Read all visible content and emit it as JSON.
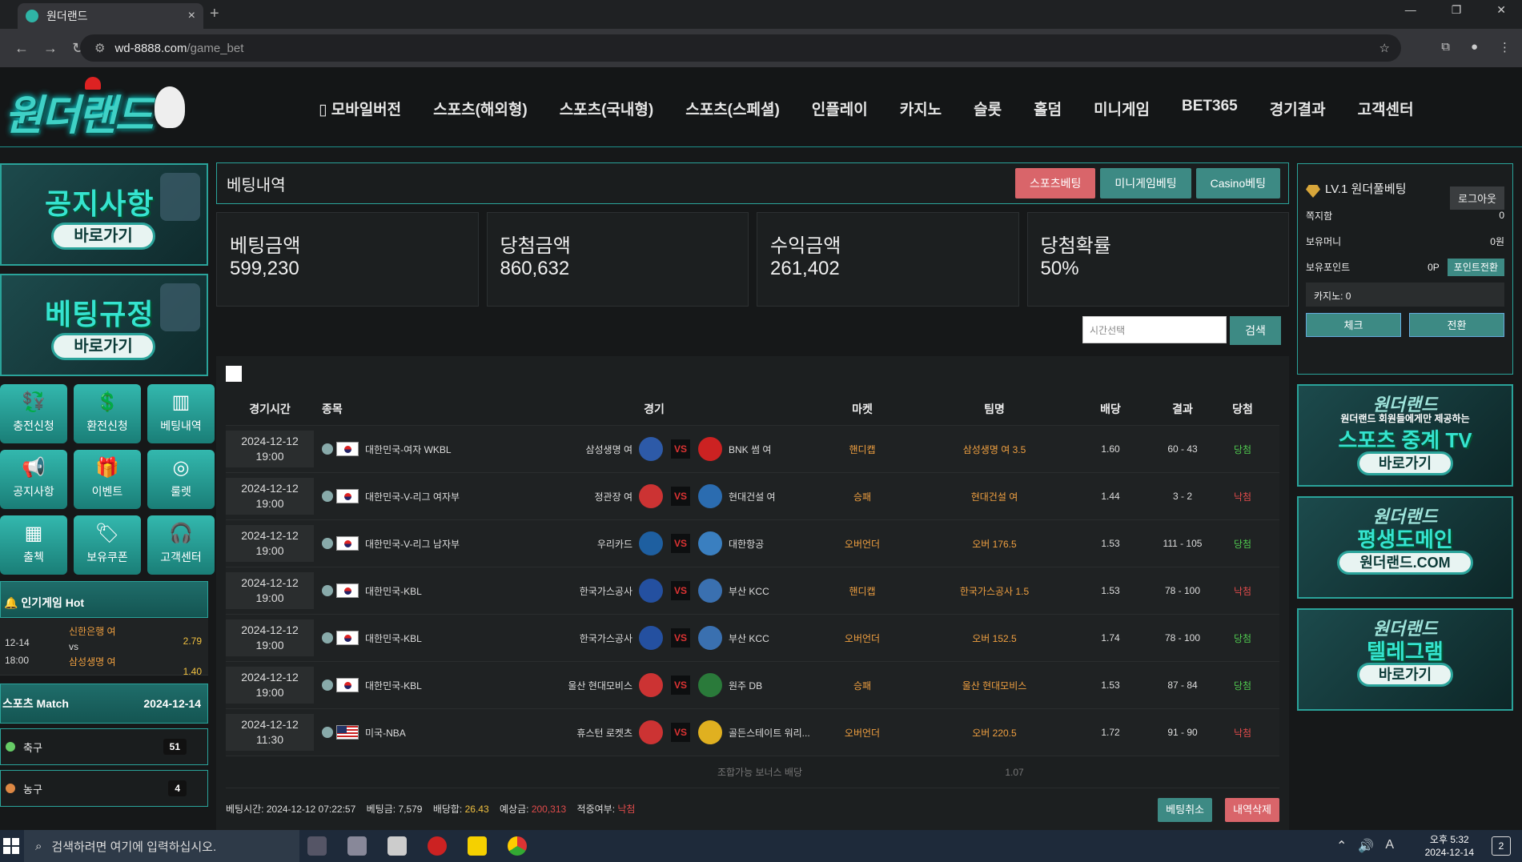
{
  "browser": {
    "tab_title": "원더랜드",
    "url_host": "wd-8888.com",
    "url_path": "/game_bet"
  },
  "header": {
    "logo_text": "원더랜드",
    "menu": [
      "▯ 모바일버전",
      "스포츠(해외형)",
      "스포츠(국내형)",
      "스포츠(스페셜)",
      "인플레이",
      "카지노",
      "슬롯",
      "홀덤",
      "미니게임",
      "BET365",
      "경기결과",
      "고객센터"
    ]
  },
  "left": {
    "banners": [
      {
        "title": "공지사항",
        "button": "바로가기"
      },
      {
        "title": "베팅규정",
        "button": "바로가기"
      }
    ],
    "quick": [
      {
        "icon": "money-icon",
        "glyph": "💱",
        "label": "충전신청"
      },
      {
        "icon": "dollar-icon",
        "glyph": "💲",
        "label": "환전신청"
      },
      {
        "icon": "list-icon",
        "glyph": "▥",
        "label": "베팅내역"
      },
      {
        "icon": "megaphone-icon",
        "glyph": "📢",
        "label": "공지사항"
      },
      {
        "icon": "gift-icon",
        "glyph": "🎁",
        "label": "이벤트"
      },
      {
        "icon": "roulette-icon",
        "glyph": "◎",
        "label": "룰렛"
      },
      {
        "icon": "calendar-icon",
        "glyph": "▦",
        "label": "출첵"
      },
      {
        "icon": "coupon-icon",
        "glyph": "🏷",
        "label": "보유쿠폰"
      },
      {
        "icon": "headset-icon",
        "glyph": "🎧",
        "label": "고객센터"
      }
    ],
    "hot": {
      "title": "🔔 인기게임 Hot",
      "date": "12-14",
      "time": "18:00",
      "team1": "신한은행 여",
      "vs": "vs",
      "team2": "삼성생명 여",
      "odd1": "2.79",
      "odd2": "1.40"
    },
    "match": {
      "title": "스포츠 Match",
      "date": "2024-12-14"
    },
    "sports": [
      {
        "name": "축구",
        "count": "51"
      },
      {
        "name": "농구",
        "count": "4"
      }
    ]
  },
  "main": {
    "title": "베팅내역",
    "tabs": [
      "스포츠베팅",
      "미니게임베팅",
      "Casino베팅"
    ],
    "stats": [
      {
        "label": "베팅금액",
        "value": "599,230"
      },
      {
        "label": "당첨금액",
        "value": "860,632"
      },
      {
        "label": "수익금액",
        "value": "261,402"
      },
      {
        "label": "당첨확률",
        "value": "50%"
      }
    ],
    "search": {
      "placeholder": "시간선택",
      "button": "검색"
    },
    "columns": [
      "경기시간",
      "종목",
      "경기",
      "마켓",
      "팀명",
      "배당",
      "결과",
      "당첨"
    ],
    "rows": [
      {
        "date": "2024-12-12",
        "time": "19:00",
        "flag": "kr",
        "league": "대한민국-여자 WKBL",
        "home": "삼성생명 여",
        "away": "BNK 썸 여",
        "market": "핸디캡",
        "pick": "삼성생명 여 3.5",
        "odd": "1.60",
        "score": "60 - 43",
        "result": "당첨",
        "win": true
      },
      {
        "date": "2024-12-12",
        "time": "19:00",
        "flag": "kr",
        "league": "대한민국-V-리그 여자부",
        "home": "정관장 여",
        "away": "현대건설 여",
        "market": "승패",
        "pick": "현대건설 여",
        "odd": "1.44",
        "score": "3 - 2",
        "result": "낙첨",
        "win": false
      },
      {
        "date": "2024-12-12",
        "time": "19:00",
        "flag": "kr",
        "league": "대한민국-V-리그 남자부",
        "home": "우리카드",
        "away": "대한항공",
        "market": "오버언더",
        "pick": "오버 176.5",
        "odd": "1.53",
        "score": "111 - 105",
        "result": "당첨",
        "win": true
      },
      {
        "date": "2024-12-12",
        "time": "19:00",
        "flag": "kr",
        "league": "대한민국-KBL",
        "home": "한국가스공사",
        "away": "부산 KCC",
        "market": "핸디캡",
        "pick": "한국가스공사 1.5",
        "odd": "1.53",
        "score": "78 - 100",
        "result": "낙첨",
        "win": false
      },
      {
        "date": "2024-12-12",
        "time": "19:00",
        "flag": "kr",
        "league": "대한민국-KBL",
        "home": "한국가스공사",
        "away": "부산 KCC",
        "market": "오버언더",
        "pick": "오버 152.5",
        "odd": "1.74",
        "score": "78 - 100",
        "result": "당첨",
        "win": true
      },
      {
        "date": "2024-12-12",
        "time": "19:00",
        "flag": "kr",
        "league": "대한민국-KBL",
        "home": "울산 현대모비스",
        "away": "원주 DB",
        "market": "승패",
        "pick": "울산 현대모비스",
        "odd": "1.53",
        "score": "87 - 84",
        "result": "당첨",
        "win": true
      },
      {
        "date": "2024-12-12",
        "time": "11:30",
        "flag": "us",
        "league": "미국-NBA",
        "home": "휴스턴 로켓츠",
        "away": "골든스테이트 워리...",
        "market": "오버언더",
        "pick": "오버 220.5",
        "odd": "1.72",
        "score": "91 - 90",
        "result": "낙첨",
        "win": false
      }
    ],
    "bonus": {
      "label": "조합가능 보너스 배당",
      "odd": "1.07"
    },
    "footer": {
      "bet_time_label": "베팅시간:",
      "bet_time": "2024-12-12 07:22:57",
      "bet_amount_label": "베팅금:",
      "bet_amount": "7,579",
      "odd_sum_label": "배당합:",
      "odd_sum": "26.43",
      "expect_label": "예상금:",
      "expect": "200,313",
      "hit_label": "적중여부:",
      "hit": "낙첨",
      "cancel": "베팅취소",
      "delete": "내역삭제"
    }
  },
  "right": {
    "user": {
      "level": "LV.1 원더풀베팅",
      "logout": "로그아웃"
    },
    "rows": [
      {
        "label": "쪽지함",
        "value": "0"
      },
      {
        "label": "보유머니",
        "value": "0원"
      }
    ],
    "point_label": "보유포인트",
    "point_value": "0P",
    "point_button": "포인트전환",
    "casino": "카지노: 0",
    "check": "체크",
    "convert": "전환",
    "banners": [
      {
        "brand": "원더랜드",
        "sub": "원더랜드 회원들에게만 제공하는",
        "big": "스포츠 중계 TV",
        "go": "바로가기"
      },
      {
        "brand": "원더랜드",
        "sub": "",
        "big": "평생도메인",
        "go": "원더랜드.COM"
      },
      {
        "brand": "원더랜드",
        "sub": "",
        "big": "텔레그램",
        "go": "바로가기"
      }
    ]
  },
  "taskbar": {
    "search_placeholder": "검색하려면 여기에 입력하십시오.",
    "time": "오후 5:32",
    "date": "2024-12-14",
    "ime": "A",
    "notif": "2"
  }
}
